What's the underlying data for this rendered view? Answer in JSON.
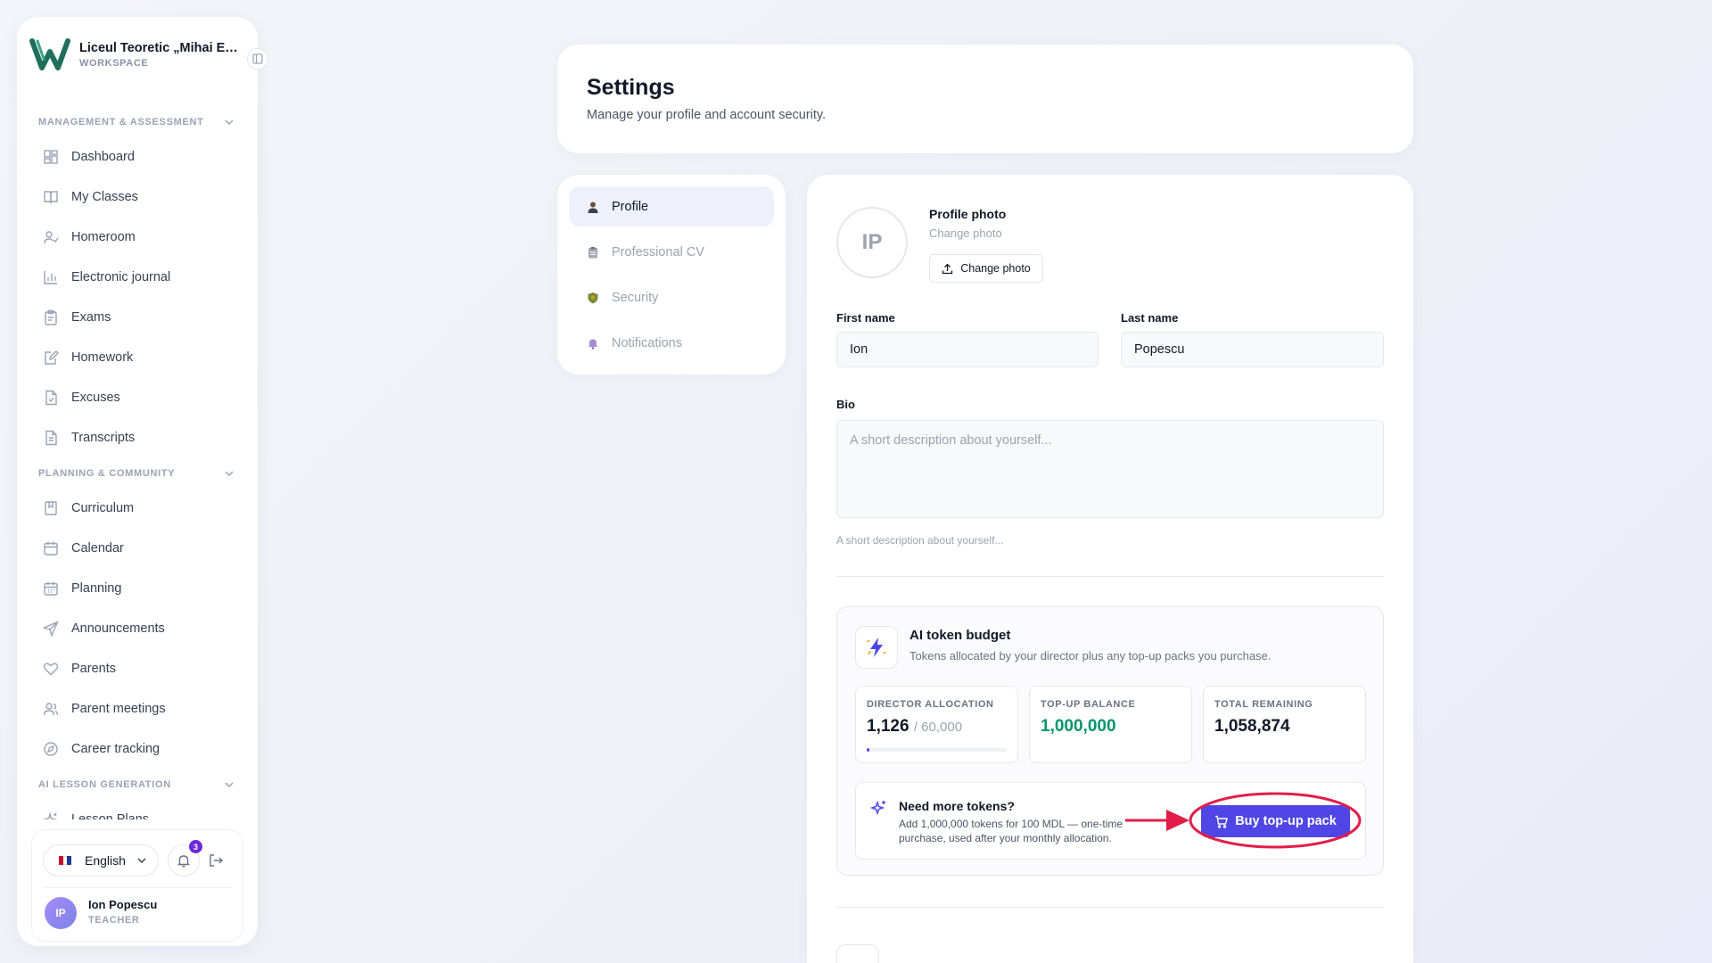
{
  "workspace": {
    "name": "Liceul Teoretic „Mihai Emi...",
    "subtitle": "WORKSPACE"
  },
  "sidebar": {
    "sections": [
      {
        "title": "MANAGEMENT & ASSESSMENT",
        "items": [
          {
            "label": "Dashboard",
            "icon": "dashboard-icon"
          },
          {
            "label": "My Classes",
            "icon": "book-icon"
          },
          {
            "label": "Homeroom",
            "icon": "user-check-icon"
          },
          {
            "label": "Electronic journal",
            "icon": "bar-chart-icon"
          },
          {
            "label": "Exams",
            "icon": "clipboard-icon"
          },
          {
            "label": "Homework",
            "icon": "edit-icon"
          },
          {
            "label": "Excuses",
            "icon": "file-check-icon"
          },
          {
            "label": "Transcripts",
            "icon": "file-text-icon"
          }
        ]
      },
      {
        "title": "PLANNING & COMMUNITY",
        "items": [
          {
            "label": "Curriculum",
            "icon": "book-bookmark-icon"
          },
          {
            "label": "Calendar",
            "icon": "calendar-icon"
          },
          {
            "label": "Planning",
            "icon": "calendar-grid-icon"
          },
          {
            "label": "Announcements",
            "icon": "send-icon"
          },
          {
            "label": "Parents",
            "icon": "heart-icon"
          },
          {
            "label": "Parent meetings",
            "icon": "users-icon"
          },
          {
            "label": "Career tracking",
            "icon": "compass-icon"
          }
        ]
      },
      {
        "title": "AI LESSON GENERATION",
        "items": [
          {
            "label": "Lesson Plans",
            "icon": "sparkles-icon"
          }
        ]
      }
    ]
  },
  "footer": {
    "language": "English",
    "notification_count": "3",
    "user_initials": "IP",
    "user_name": "Ion Popescu",
    "user_role": "TEACHER"
  },
  "header": {
    "title": "Settings",
    "subtitle": "Manage your profile and account security."
  },
  "tabs": [
    {
      "label": "Profile",
      "icon": "person-icon",
      "active": true
    },
    {
      "label": "Professional CV",
      "icon": "document-icon",
      "active": false
    },
    {
      "label": "Security",
      "icon": "shield-icon",
      "active": false
    },
    {
      "label": "Notifications",
      "icon": "bell-icon",
      "active": false
    }
  ],
  "profile": {
    "initials": "IP",
    "photo_title": "Profile photo",
    "photo_subtitle": "Change photo",
    "photo_button": "Change photo",
    "first_name_label": "First name",
    "first_name": "Ion",
    "last_name_label": "Last name",
    "last_name": "Popescu",
    "bio_label": "Bio",
    "bio_placeholder": "A short description about yourself...",
    "bio_hint": "A short description about yourself..."
  },
  "tokens": {
    "title": "AI token budget",
    "subtitle": "Tokens allocated by your director plus any top-up packs you purchase.",
    "director_label": "DIRECTOR ALLOCATION",
    "director_value": "1,126",
    "director_total": "/ 60,000",
    "director_fraction": 0.019,
    "topup_label": "TOP-UP BALANCE",
    "topup_value": "1,000,000",
    "remaining_label": "TOTAL REMAINING",
    "remaining_value": "1,058,874",
    "need_title": "Need more tokens?",
    "need_desc": "Add 1,000,000 tokens for 100 MDL — one-time purchase, used after your monthly allocation.",
    "buy_button": "Buy top-up pack"
  },
  "colors": {
    "accent": "#4f46e5",
    "green": "#059669",
    "annotation": "#e11d48"
  }
}
